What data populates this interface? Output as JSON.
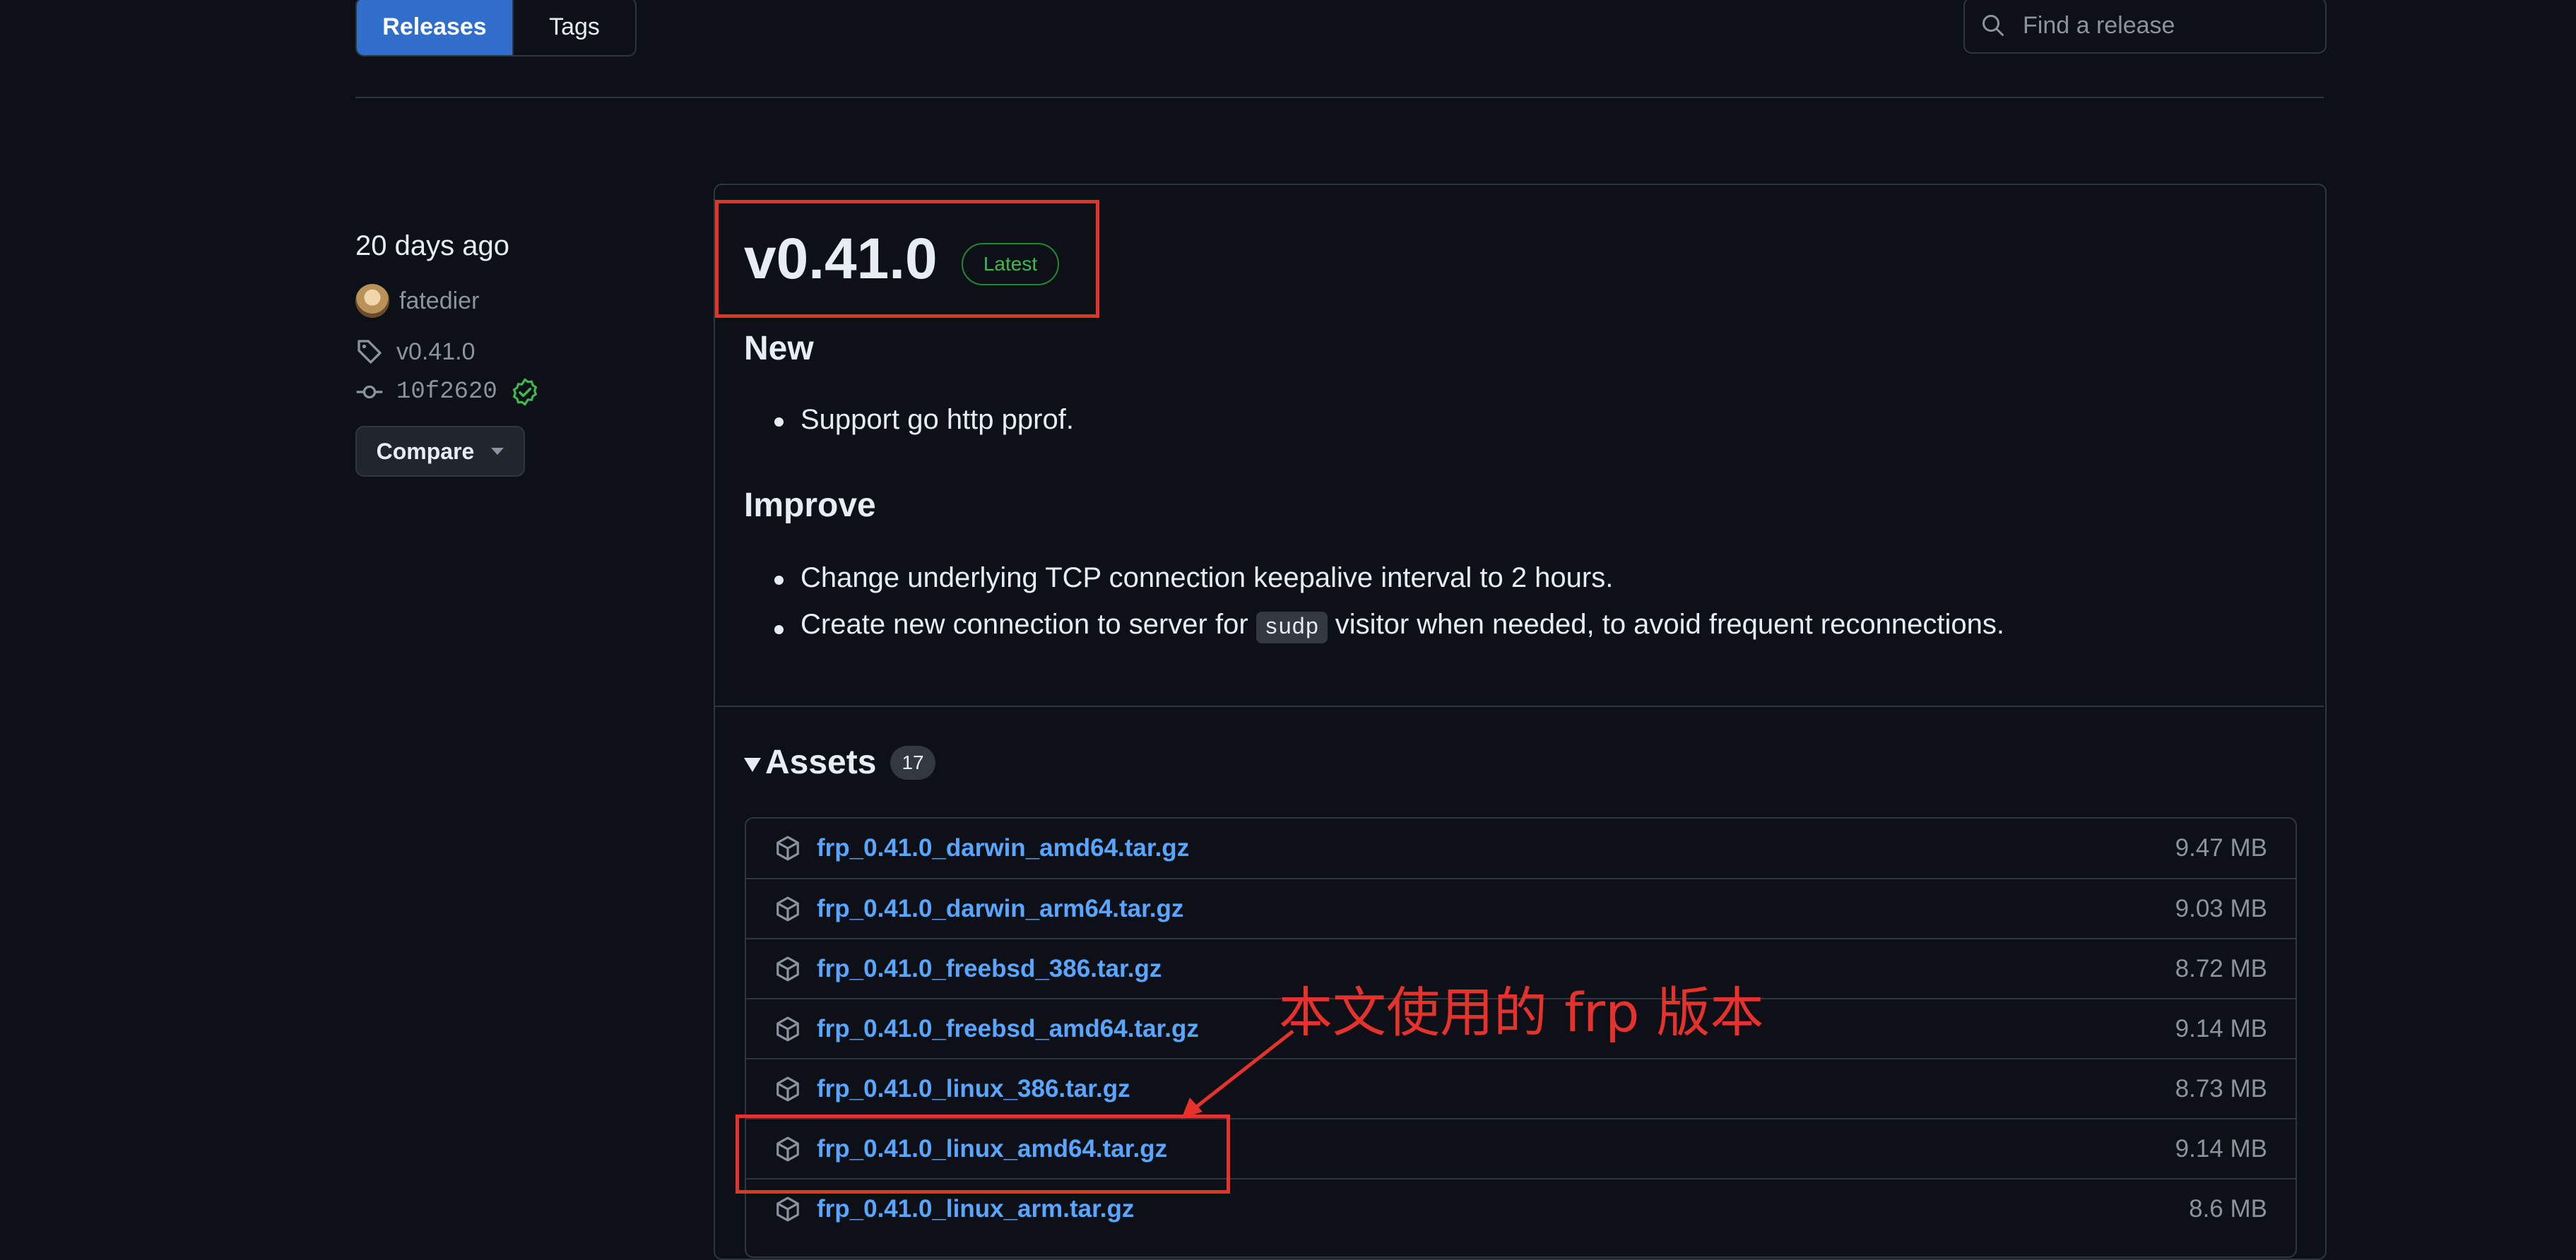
{
  "header": {
    "tabs": [
      {
        "label": "Releases",
        "active": true
      },
      {
        "label": "Tags",
        "active": false
      }
    ],
    "search_placeholder": "Find a release"
  },
  "meta": {
    "date": "20 days ago",
    "author": "fatedier",
    "tag": "v0.41.0",
    "commit": "10f2620",
    "compare_label": "Compare"
  },
  "release": {
    "title": "v0.41.0",
    "badge": "Latest",
    "sections": [
      {
        "heading": "New",
        "items": [
          "Support go http pprof."
        ]
      },
      {
        "heading": "Improve",
        "items": [
          "Change underlying TCP connection keepalive interval to 2 hours.",
          {
            "before": "Create new connection to server for ",
            "code": "sudp",
            "after": " visitor when needed, to avoid frequent reconnections."
          }
        ]
      }
    ]
  },
  "assets": {
    "label": "Assets",
    "count": "17",
    "items": [
      {
        "name": "frp_0.41.0_darwin_amd64.tar.gz",
        "size": "9.47 MB"
      },
      {
        "name": "frp_0.41.0_darwin_arm64.tar.gz",
        "size": "9.03 MB"
      },
      {
        "name": "frp_0.41.0_freebsd_386.tar.gz",
        "size": "8.72 MB"
      },
      {
        "name": "frp_0.41.0_freebsd_amd64.tar.gz",
        "size": "9.14 MB"
      },
      {
        "name": "frp_0.41.0_linux_386.tar.gz",
        "size": "8.73 MB"
      },
      {
        "name": "frp_0.41.0_linux_amd64.tar.gz",
        "size": "9.14 MB"
      },
      {
        "name": "frp_0.41.0_linux_arm.tar.gz",
        "size": "8.6 MB"
      }
    ]
  },
  "annotation": {
    "text": "本文使用的 frp 版本",
    "color": "#e5322d"
  },
  "colors": {
    "background": "#0d1117",
    "accent": "#316dca",
    "link": "#58a6ff",
    "success": "#3fb950"
  }
}
